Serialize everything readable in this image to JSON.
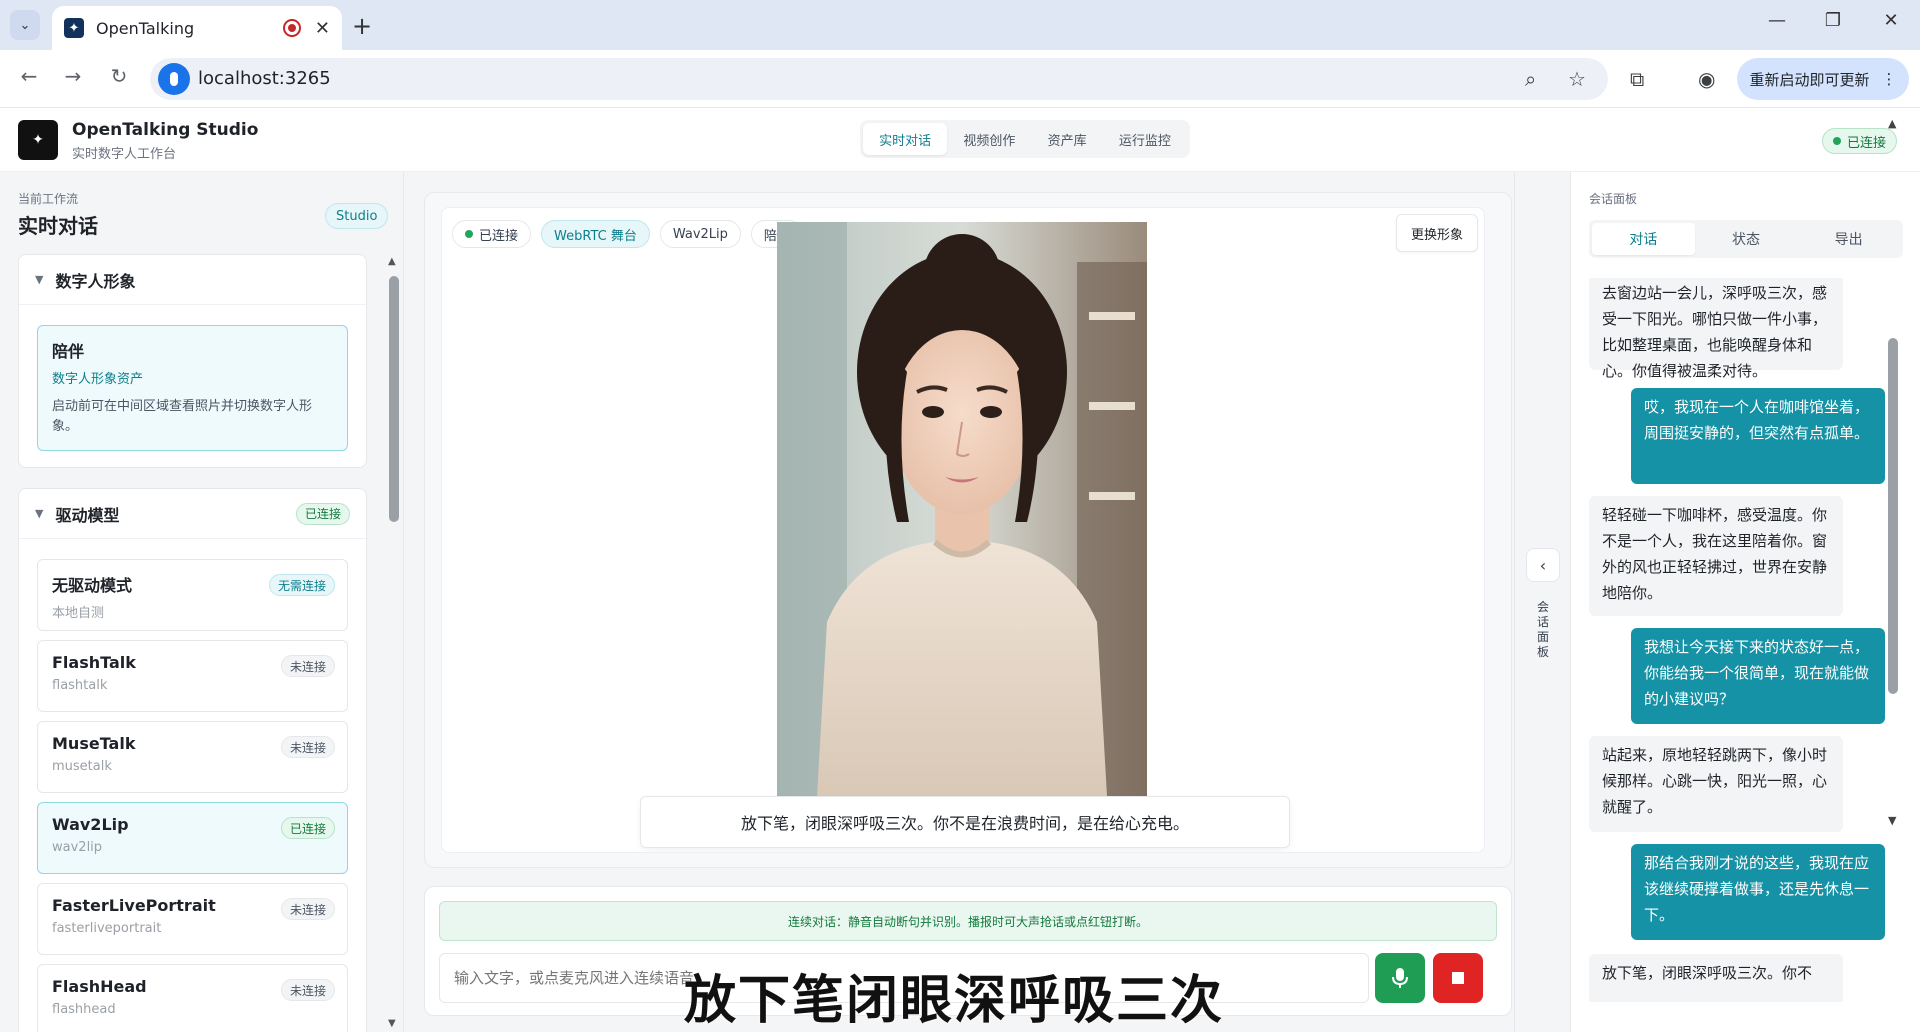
{
  "browser": {
    "tab_title": "OpenTalking",
    "url": "localhost:3265",
    "update_button": "重新启动即可更新"
  },
  "header": {
    "brand_title": "OpenTalking Studio",
    "brand_subtitle": "实时数字人工作台",
    "nav": [
      "实时对话",
      "视频创作",
      "资产库",
      "运行监控"
    ],
    "active_nav": "实时对话",
    "status": "已连接"
  },
  "left": {
    "workflow_label": "当前工作流",
    "workflow_title": "实时对话",
    "studio_badge": "Studio",
    "avatar_section": {
      "title": "数字人形象",
      "item": {
        "name": "陪伴",
        "subtitle": "数字人形象资产",
        "description": "启动前可在中间区域查看照片并切换数字人形象。"
      }
    },
    "model_section": {
      "title": "驱动模型",
      "status": "已连接",
      "models": [
        {
          "name": "无驱动模式",
          "sub": "本地自测",
          "status": "无需连接",
          "active": false
        },
        {
          "name": "FlashTalk",
          "sub": "flashtalk",
          "status": "未连接",
          "active": false
        },
        {
          "name": "MuseTalk",
          "sub": "musetalk",
          "status": "未连接",
          "active": false
        },
        {
          "name": "Wav2Lip",
          "sub": "wav2lip",
          "status": "已连接",
          "active": true
        },
        {
          "name": "FasterLivePortrait",
          "sub": "fasterliveportrait",
          "status": "未连接",
          "active": false
        },
        {
          "name": "FlashHead",
          "sub": "flashhead",
          "status": "未连接",
          "active": false
        }
      ]
    }
  },
  "stage": {
    "tags": [
      "已连接",
      "WebRTC 舞台",
      "Wav2Lip",
      "陪伴"
    ],
    "swap_button": "更换形象",
    "subtitle": "放下笔，闭眼深呼吸三次。你不是在浪费时间，是在给心充电。"
  },
  "input": {
    "hint": "连续对话：静音自动断句并识别。播报时可大声抢话或点红钮打断。",
    "placeholder": "输入文字，或点麦克风进入连续语音",
    "overlay_caption": "放下笔闭眼深呼吸三次"
  },
  "collapse": {
    "label": "会话面板"
  },
  "right": {
    "title": "会话面板",
    "tabs": [
      "对话",
      "状态",
      "导出"
    ],
    "active_tab": "对话",
    "messages": [
      {
        "role": "ai",
        "text": "去窗边站一会儿，深呼吸三次，感受一下阳光。哪怕只做一件小事，比如整理桌面，也能唤醒身体和心。你值得被温柔对待。"
      },
      {
        "role": "user",
        "text": "哎，我现在一个人在咖啡馆坐着，周围挺安静的，但突然有点孤单。"
      },
      {
        "role": "ai",
        "text": "轻轻碰一下咖啡杯，感受温度。你不是一个人，我在这里陪着你。窗外的风也正轻轻拂过，世界在安静地陪你。"
      },
      {
        "role": "user",
        "text": "我想让今天接下来的状态好一点，你能给我一个很简单，现在就能做的小建议吗？"
      },
      {
        "role": "ai",
        "text": "站起来，原地轻轻跳两下，像小时候那样。心跳一快，阳光一照，心就醒了。"
      },
      {
        "role": "user",
        "text": "那结合我刚才说的这些，我现在应该继续硬撑着做事，还是先休息一下。"
      },
      {
        "role": "ai",
        "text": "放下笔，闭眼深呼吸三次。你不"
      }
    ]
  }
}
